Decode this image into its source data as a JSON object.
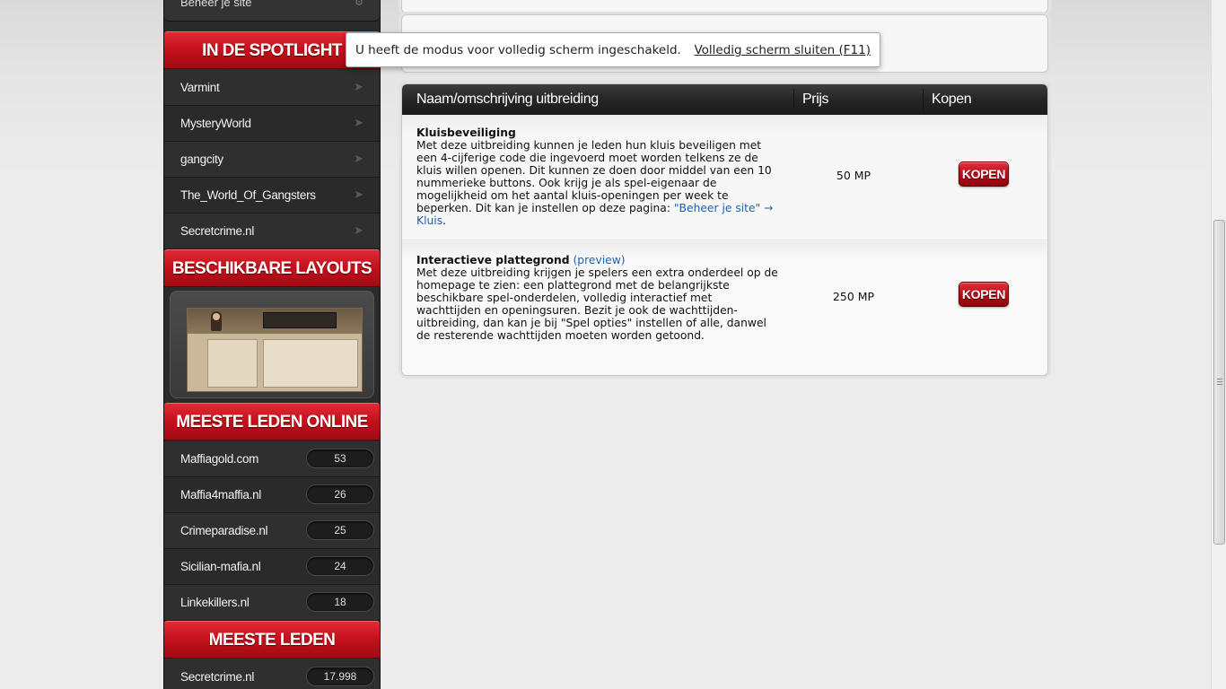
{
  "sidebar": {
    "top_item": "Beheer je site",
    "spotlight": {
      "title": "IN DE SPOTLIGHT",
      "items": [
        "Varmint",
        "MysteryWorld",
        "gangcity",
        "The_World_Of_Gangsters",
        "Secretcrime.nl"
      ]
    },
    "layouts": {
      "title": "BESCHIKBARE LAYOUTS"
    },
    "online": {
      "title": "MEESTE LEDEN ONLINE",
      "items": [
        {
          "name": "Maffiagold.com",
          "count": "53"
        },
        {
          "name": "Maffia4maffia.nl",
          "count": "26"
        },
        {
          "name": "Crimeparadise.nl",
          "count": "25"
        },
        {
          "name": "Sicilian-mafia.nl",
          "count": "24"
        },
        {
          "name": "Linkekillers.nl",
          "count": "18"
        }
      ]
    },
    "members": {
      "title": "MEESTE LEDEN",
      "items": [
        {
          "name": "Secretcrime.nl",
          "count": "17.998"
        }
      ]
    }
  },
  "fullscreen_notice": {
    "text": "U heeft de modus voor volledig scherm ingeschakeld.",
    "exit_link": "Volledig scherm sluiten (F11)"
  },
  "table": {
    "headers": {
      "name": "Naam/omschrijving uitbreiding",
      "price": "Prijs",
      "buy": "Kopen"
    },
    "rows": [
      {
        "title": "Kluisbeveiliging",
        "description": "Met deze uitbreiding kunnen je leden hun kluis beveiligen met een 4-cijferige code die ingevoerd moet worden telkens ze de kluis willen openen. Dit kunnen ze doen door middel van een 10 nummerieke buttons. Ook krijg je als spel-eigenaar de mogelijkheid om het aantal kluis-openingen per week te beperken. Dit kan je instellen op deze pagina: ",
        "link": "\"Beheer je site\" → Kluis",
        "after_link": ".",
        "price": "50 MP",
        "button": "KOPEN"
      },
      {
        "title": "Interactieve plattegrond",
        "preview": "(preview)",
        "description": "Met deze uitbreiding krijgen je spelers een extra onderdeel op de homepage te zien: een plattegrond met de belangrijkste beschikbare spel-onderdelen, volledig interactief met wachttijden en openingsuren. Bezit je ook de wachttijden-uitbreiding, dan kan je bij \"Spel opties\" instellen of alle, danwel de resterende wachttijden moeten worden getoond.",
        "price": "250 MP",
        "button": "KOPEN"
      }
    ]
  }
}
